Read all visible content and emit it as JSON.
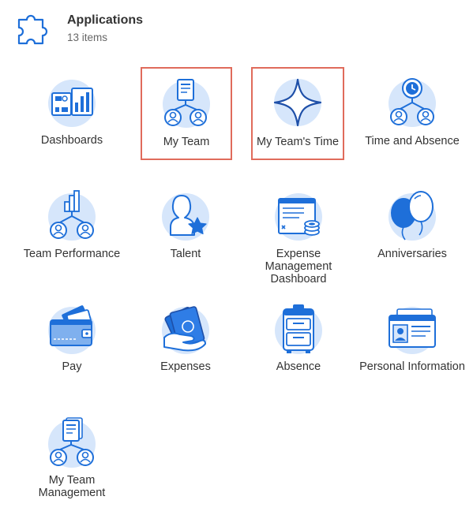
{
  "header": {
    "title": "Applications",
    "count": "13 items",
    "icon": "puzzle-piece-icon"
  },
  "apps": [
    {
      "label": "Dashboards",
      "icon": "dashboards-icon",
      "highlighted": false
    },
    {
      "label": "My Team",
      "icon": "team-org-icon",
      "highlighted": true
    },
    {
      "label": "My Team's Time",
      "icon": "sparkle-star-icon",
      "highlighted": true
    },
    {
      "label": "Time and Absence",
      "icon": "clock-team-icon",
      "highlighted": false
    },
    {
      "label": "Team Performance",
      "icon": "team-performance-icon",
      "highlighted": false
    },
    {
      "label": "Talent",
      "icon": "talent-person-star-icon",
      "highlighted": false
    },
    {
      "label": "Expense Management Dashboard",
      "icon": "expense-report-coins-icon",
      "highlighted": false
    },
    {
      "label": "Anniversaries",
      "icon": "balloons-icon",
      "highlighted": false
    },
    {
      "label": "Pay",
      "icon": "wallet-money-icon",
      "highlighted": false
    },
    {
      "label": "Expenses",
      "icon": "hand-cash-icon",
      "highlighted": false
    },
    {
      "label": "Absence",
      "icon": "suitcase-icon",
      "highlighted": false
    },
    {
      "label": "Personal Information",
      "icon": "id-card-icon",
      "highlighted": false
    },
    {
      "label": "My Team Management",
      "icon": "team-management-icon",
      "highlighted": false
    }
  ],
  "colors": {
    "icon_blue": "#1e6fd9",
    "icon_light": "#d6e6fb",
    "highlight_border": "#e06b5b"
  }
}
